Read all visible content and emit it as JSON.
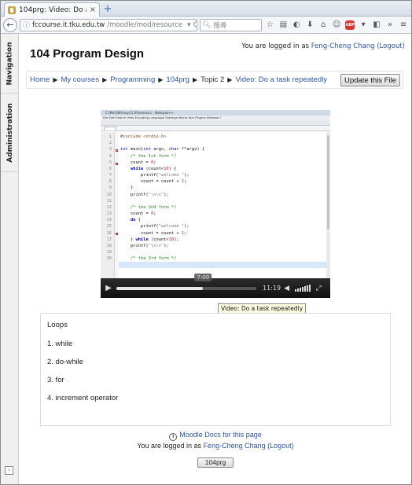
{
  "browser": {
    "tab_title": "104prg: Video: Do a t...",
    "tab_close": "×",
    "new_tab": "+",
    "url_host": "fccourse.it.tku.edu.tw",
    "url_path": "/moodle/mod/resource",
    "reload": "C",
    "search_placeholder": "搜尋"
  },
  "dock": {
    "navigation": "Navigation",
    "administration": "Administration",
    "collapse": "›"
  },
  "header": {
    "logged_in_prefix": "You are logged in as ",
    "user_name": "Feng-Cheng Chang",
    "logout": "(Logout)",
    "course_title": "104 Program Design"
  },
  "breadcrumb": {
    "items": [
      "Home",
      "My courses",
      "Programming",
      "104prg",
      "Topic 2",
      "Video: Do a task repeatedly"
    ],
    "separator": "▶",
    "update_button": "Update this File"
  },
  "video": {
    "ide_title": "C:\\MinGW\\msys\\1.0\\home\\a.c - Notepad++",
    "ide_menu": "File  Edit  Search  View  Encoding  Language  Settings  Macro  Run  Plugins  Window  ?",
    "line_numbers": [
      "1",
      "2",
      "3",
      "4",
      "5",
      "6",
      "7",
      "8",
      "9",
      "10",
      "11",
      "12",
      "13",
      "14",
      "15",
      "16",
      "17",
      "18",
      "19",
      "20"
    ],
    "current_time": "7:00",
    "duration": "11:19",
    "progress_fraction": 0.62,
    "tooltip": "Video: Do a task repeatedly"
  },
  "content": {
    "title": "Loops",
    "items": [
      "1. while",
      "2. do-while",
      "3. for",
      "4. increment operator"
    ]
  },
  "footer": {
    "docs_link": "Moodle Docs for this page",
    "logged_in_prefix": "You are logged in as ",
    "user_name": "Feng-Cheng Chang",
    "logout": "(Logout)",
    "course_button": "104prg"
  }
}
